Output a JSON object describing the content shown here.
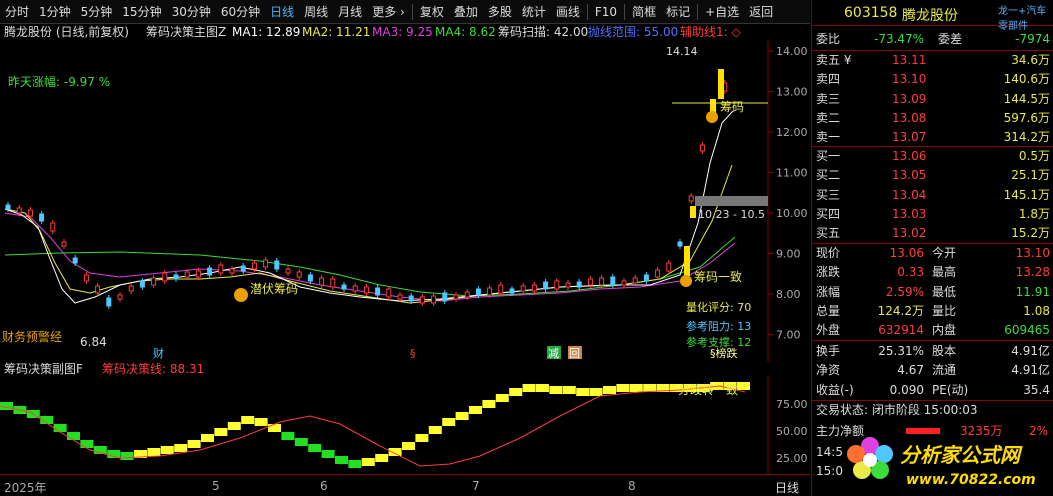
{
  "toolbar": {
    "items": [
      "分时",
      "1分钟",
      "5分钟",
      "15分钟",
      "30分钟",
      "60分钟",
      "日线",
      "周线",
      "月线",
      "更多 ›",
      "复权",
      "叠加",
      "多股",
      "统计",
      "画线",
      "F10",
      "简框",
      "标记",
      "+自选",
      "返回"
    ],
    "active_index": 6
  },
  "info": {
    "stock": "腾龙股份 (日线,前复权)",
    "indicator": "筹码决策主图Z",
    "ma1": "MA1: 12.89",
    "ma2": "MA2: 11.21",
    "ma3": "MA3: 9.25",
    "ma4": "MA4: 8.62",
    "scan": "筹码扫描: 42.00",
    "range": "抛线范围: 55.00",
    "aux": "辅助线1: ◇"
  },
  "chart": {
    "y_ticks": [
      "14.00",
      "13.00",
      "12.00",
      "11.00",
      "10.00",
      "9.00",
      "8.00",
      "7.00"
    ],
    "yesterday_change": "昨天涨幅: -9.97 %",
    "high_label": "14.14",
    "low_label": "6.84",
    "cost_label": "10.23 - 10.5",
    "chip_labels": {
      "chips": "筹码",
      "consistent": "筹码一致",
      "hidden": "潜伏筹码"
    },
    "quant_score": "量化评分: 70",
    "resistance": "参考阻力: 13",
    "support": "参考支撑: 12",
    "finance_warning": "财务预警经",
    "sub_title": "筹码决策副图F",
    "sub_line": "筹码决策线: 88.31",
    "sub_ticks": [
      "75.00",
      "50.00",
      "25.00"
    ],
    "sub_label": "分歧转一致",
    "markers": {
      "cai": "财",
      "s1": "§",
      "jian": "减",
      "hui": "回",
      "s2": "§榜跌"
    }
  },
  "dates": {
    "year": "2025年",
    "m5": "5",
    "m6": "6",
    "m7": "7",
    "m8": "8",
    "period": "日线"
  },
  "quote": {
    "code": "603158",
    "name": "腾龙股份",
    "link": "龙一+汽车零部件",
    "weibi_label": "委比",
    "weibi_value": "-73.47%",
    "weicha_label": "委差",
    "weicha_value": "-7974",
    "asks": [
      {
        "label": "卖五 ¥",
        "price": "13.11",
        "vol": "34.6万"
      },
      {
        "label": "卖四",
        "price": "13.10",
        "vol": "140.6万"
      },
      {
        "label": "卖三",
        "price": "13.09",
        "vol": "144.5万"
      },
      {
        "label": "卖二",
        "price": "13.08",
        "vol": "597.6万"
      },
      {
        "label": "卖一",
        "price": "13.07",
        "vol": "314.2万"
      }
    ],
    "bids": [
      {
        "label": "买一",
        "price": "13.06",
        "vol": "0.5万"
      },
      {
        "label": "买二",
        "price": "13.05",
        "vol": "25.1万"
      },
      {
        "label": "买三",
        "price": "13.04",
        "vol": "145.1万"
      },
      {
        "label": "买四",
        "price": "13.03",
        "vol": "1.8万"
      },
      {
        "label": "买五",
        "price": "13.02",
        "vol": "15.2万"
      }
    ],
    "stats": [
      {
        "l1": "现价",
        "v1": "13.06",
        "l2": "今开",
        "v2": "13.10"
      },
      {
        "l1": "涨跌",
        "v1": "0.33",
        "l2": "最高",
        "v2": "13.28"
      },
      {
        "l1": "涨幅",
        "v1": "2.59%",
        "l2": "最低",
        "v2": "11.91"
      },
      {
        "l1": "总量",
        "v1": "124.2万",
        "l2": "量比",
        "v2": "1.08"
      },
      {
        "l1": "外盘",
        "v1": "632914",
        "l2": "内盘",
        "v2": "609465"
      }
    ],
    "stats2": [
      {
        "l1": "换手",
        "v1": "25.31%",
        "l2": "股本",
        "v2": "4.91亿"
      },
      {
        "l1": "净资",
        "v1": "4.67",
        "l2": "流通",
        "v2": "4.91亿"
      },
      {
        "l1": "收益(-)",
        "v1": "0.090",
        "l2": "PE(动)",
        "v2": "35.4"
      }
    ],
    "status": "交易状态: 闭市阶段 15:00:03",
    "netflow_label": "主力净额",
    "netflow_value": "3235万",
    "netflow_pct": "2%",
    "time1": "14:5",
    "time2": "15:0"
  },
  "logo": {
    "text": "分析家公式网",
    "url": "www.70822.com"
  }
}
